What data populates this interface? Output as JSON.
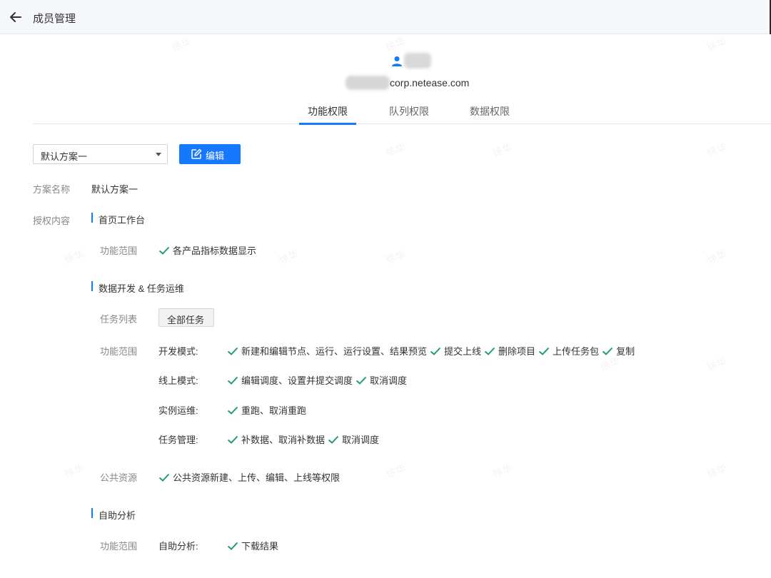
{
  "header": {
    "title": "成员管理"
  },
  "user": {
    "email_suffix": "corp.netease.com"
  },
  "tabs": [
    {
      "label": "功能权限",
      "active": true
    },
    {
      "label": "队列权限",
      "active": false
    },
    {
      "label": "数据权限",
      "active": false
    }
  ],
  "plan_select": {
    "value": "默认方案一"
  },
  "edit_button": {
    "label": "编辑"
  },
  "plan_name": {
    "label": "方案名称",
    "value": "默认方案一"
  },
  "auth_content": {
    "label": "授权内容"
  },
  "sections": {
    "homepage": {
      "title": "首页工作台",
      "scope_label": "功能范围",
      "perms": [
        "各产品指标数据显示"
      ]
    },
    "dev_ops": {
      "title": "数据开发 & 任务运维",
      "task_list_label": "任务列表",
      "task_list_button": "全部任务",
      "scope_label": "功能范围",
      "modes": [
        {
          "name": "开发模式:",
          "perms": [
            "新建和编辑节点、运行、运行设置、结果预览",
            "提交上线",
            "删除项目",
            "上传任务包",
            "复制"
          ]
        },
        {
          "name": "线上模式:",
          "perms": [
            "编辑调度、设置并提交调度",
            "取消调度"
          ]
        },
        {
          "name": "实例运维:",
          "perms": [
            "重跑、取消重跑"
          ]
        },
        {
          "name": "任务管理:",
          "perms": [
            "补数据、取消补数据",
            "取消调度"
          ]
        }
      ],
      "public_label": "公共资源",
      "public_perms": [
        "公共资源新建、上传、编辑、上线等权限"
      ]
    },
    "self_analysis": {
      "title": "自助分析",
      "scope_label": "功能范围",
      "mode_name": "自助分析:",
      "perms": [
        "下载结果"
      ]
    }
  },
  "watermark": "徐华",
  "colors": {
    "accent": "#1677ff",
    "check": "#1e9e6a"
  }
}
